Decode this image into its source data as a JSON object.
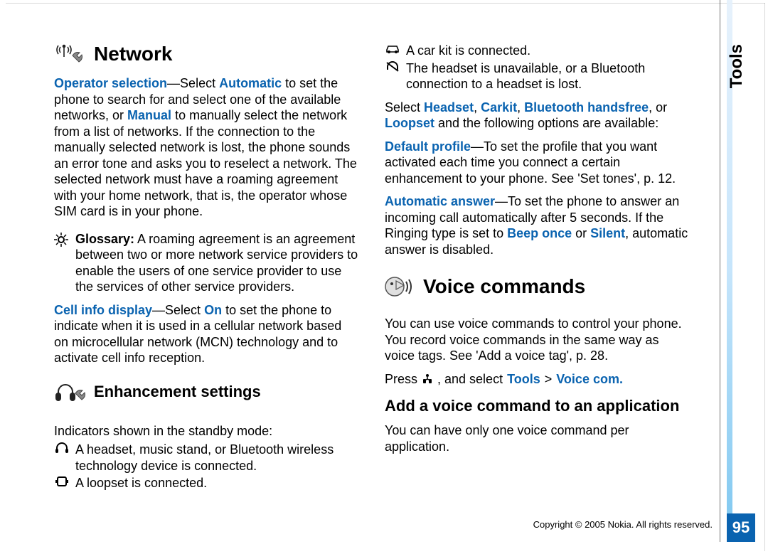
{
  "side_tab": "Tools",
  "page_number": "95",
  "footer": "Copyright © 2005 Nokia. All rights reserved.",
  "left": {
    "network": {
      "title": "Network",
      "p1_kw1": "Operator selection",
      "p1_dash": "—Select ",
      "p1_kw2": "Automatic",
      "p1_after_kw2": " to set the phone to search for and select one of the available networks, or ",
      "p1_kw3": "Manual",
      "p1_after_kw3": " to manually select the network from a list of networks. If the connection to the manually selected network is lost, the phone sounds an error tone and asks you to reselect a network. The selected network must have a roaming agreement with your home network, that is, the operator whose SIM card is in your phone.",
      "glossary_label": "Glossary:",
      "glossary_text": " A roaming agreement is an agreement between two or more network service providers to enable the users of one service provider to use the services of other service providers.",
      "p2_kw1": "Cell info display",
      "p2_dash": "—Select ",
      "p2_kw2": "On",
      "p2_after_kw2": " to set the phone to indicate when it is used in a cellular network based on microcellular network (MCN) technology and to activate cell info reception."
    },
    "enhance": {
      "title": "Enhancement settings",
      "intro": "Indicators shown in the standby mode:",
      "ind1": "A headset, music stand, or Bluetooth wireless technology device is connected.",
      "ind2": "A loopset is connected."
    }
  },
  "right": {
    "ind3": "A car kit is connected.",
    "ind4": "The headset is unavailable, or a Bluetooth connection to a headset is lost.",
    "select_pre": "Select ",
    "select_kw1": "Headset",
    "select_sep": ", ",
    "select_kw2": "Carkit",
    "select_kw3": "Bluetooth handsfree",
    "select_or": ", or ",
    "select_kw4": "Loopset",
    "select_after": " and the following options are available:",
    "dp_kw": "Default profile",
    "dp_text": "—To set the profile that you want activated each time you connect a certain enhancement to your phone. See 'Set tones', p. 12.",
    "aa_kw": "Automatic answer",
    "aa_text1": "—To set the phone to answer an incoming call automatically after 5 seconds. If the Ringing type is set to ",
    "aa_kw2": "Beep once",
    "aa_or": " or ",
    "aa_kw3": "Silent",
    "aa_text2": ", automatic answer is disabled.",
    "voice": {
      "title": "Voice commands",
      "p1": "You can use voice commands to control your phone. You record voice commands in the same way as voice tags. See 'Add a voice tag', p. 28.",
      "press_pre": "Press  ",
      "press_mid": " , and select ",
      "press_kw1": "Tools",
      "press_gt": " > ",
      "press_kw2": "Voice com.",
      "sub_title": "Add a voice command to an application",
      "sub_p": "You can have only one voice command per application."
    }
  }
}
